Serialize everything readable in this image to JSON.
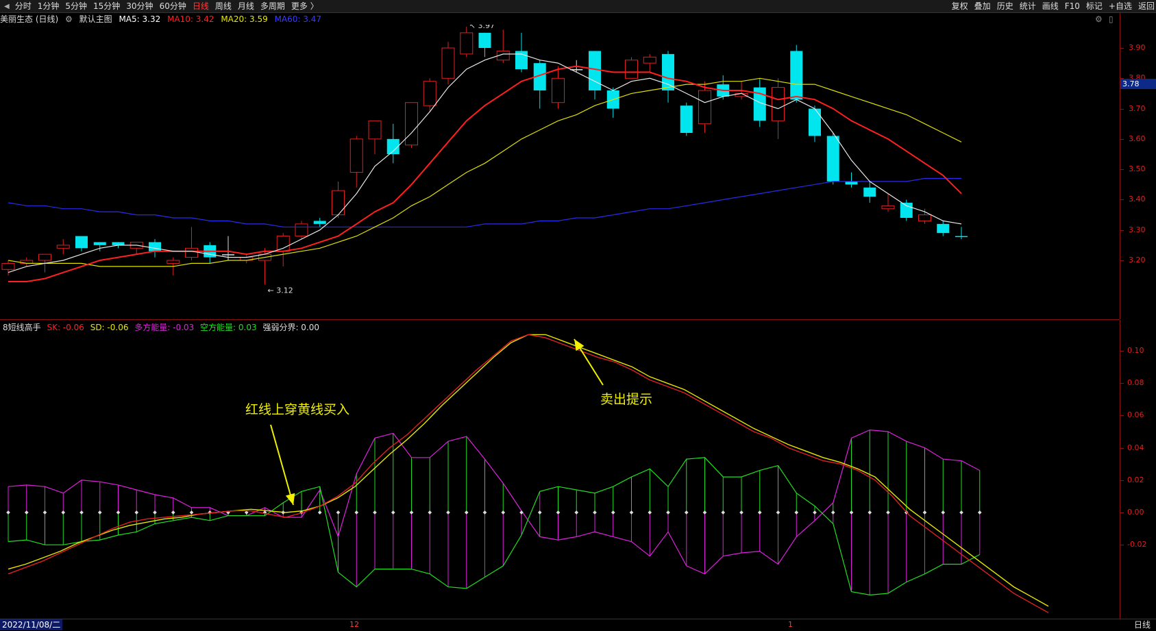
{
  "tabs": [
    {
      "label": "分时"
    },
    {
      "label": "1分钟"
    },
    {
      "label": "5分钟"
    },
    {
      "label": "15分钟"
    },
    {
      "label": "30分钟"
    },
    {
      "label": "60分钟"
    },
    {
      "label": "日线",
      "active": true
    },
    {
      "label": "周线"
    },
    {
      "label": "月线"
    },
    {
      "label": "多周期"
    },
    {
      "label": "更多 〉"
    }
  ],
  "right_tools": [
    {
      "label": "复权"
    },
    {
      "label": "叠加"
    },
    {
      "label": "历史"
    },
    {
      "label": "统计"
    },
    {
      "label": "画线"
    },
    {
      "label": "F10"
    },
    {
      "label": "标记"
    },
    {
      "label": "+自选"
    },
    {
      "label": "返回"
    }
  ],
  "main_info": {
    "stock": "美丽生态 (日线)",
    "layout": "默认主图",
    "ma5": "MA5: 3.32",
    "ma10": "MA10: 3.42",
    "ma20": "MA20: 3.59",
    "ma60": "MA60: 3.47",
    "colors": {
      "ma5": "#ffffff",
      "ma10": "#ff2020",
      "ma20": "#e8e800",
      "ma60": "#2a2aff"
    }
  },
  "indicator_info": {
    "name": "8短线高手",
    "sk": "SK: -0.06",
    "sd": "SD: -0.06",
    "duo": "多方能量: -0.03",
    "kong": "空方能量: 0.03",
    "qr": "强弱分界: 0.00"
  },
  "price_axis": [
    "3.90",
    "3.80",
    "3.70",
    "3.60",
    "3.50",
    "3.40",
    "3.30",
    "3.20"
  ],
  "price_current": "3.78",
  "ind_axis": [
    "0.10",
    "0.08",
    "0.06",
    "0.04",
    "0.02",
    "0.00",
    "-0.02"
  ],
  "annotations": {
    "buy": "红线上穿黄线买入",
    "sell": "卖出提示",
    "high": "3.97",
    "low": "3.12"
  },
  "bottom": {
    "date": "2022/11/08/二",
    "month12": "12",
    "month1": "1",
    "period": "日线"
  },
  "chart_data": {
    "type": "candlestick",
    "candles": [
      [
        3.17,
        3.19,
        3.15,
        3.2,
        "up"
      ],
      [
        3.19,
        3.2,
        3.18,
        3.21,
        "up"
      ],
      [
        3.2,
        3.22,
        3.16,
        3.22,
        "up"
      ],
      [
        3.24,
        3.25,
        3.22,
        3.27,
        "up"
      ],
      [
        3.28,
        3.24,
        3.23,
        3.28,
        "down"
      ],
      [
        3.26,
        3.25,
        3.23,
        3.26,
        "down"
      ],
      [
        3.26,
        3.25,
        3.24,
        3.26,
        "down"
      ],
      [
        3.24,
        3.26,
        3.22,
        3.26,
        "up"
      ],
      [
        3.26,
        3.23,
        3.21,
        3.27,
        "down"
      ],
      [
        3.19,
        3.2,
        3.15,
        3.21,
        "up"
      ],
      [
        3.21,
        3.24,
        3.2,
        3.31,
        "up"
      ],
      [
        3.25,
        3.21,
        3.19,
        3.26,
        "down"
      ],
      [
        3.22,
        3.21,
        3.2,
        3.28,
        "flat"
      ],
      [
        3.2,
        3.21,
        3.19,
        3.22,
        "up"
      ],
      [
        3.2,
        3.22,
        3.12,
        3.24,
        "up"
      ],
      [
        3.23,
        3.28,
        3.18,
        3.29,
        "up"
      ],
      [
        3.28,
        3.32,
        3.27,
        3.33,
        "up"
      ],
      [
        3.32,
        3.33,
        3.31,
        3.34,
        "down"
      ],
      [
        3.35,
        3.43,
        3.34,
        3.46,
        "up"
      ],
      [
        3.49,
        3.6,
        3.44,
        3.61,
        "up"
      ],
      [
        3.6,
        3.66,
        3.55,
        3.66,
        "up"
      ],
      [
        3.6,
        3.55,
        3.52,
        3.65,
        "down"
      ],
      [
        3.58,
        3.72,
        3.57,
        3.72,
        "up"
      ],
      [
        3.71,
        3.79,
        3.69,
        3.8,
        "up"
      ],
      [
        3.8,
        3.9,
        3.78,
        3.92,
        "up"
      ],
      [
        3.88,
        3.95,
        3.87,
        3.97,
        "up"
      ],
      [
        3.95,
        3.9,
        3.87,
        3.95,
        "down"
      ],
      [
        3.86,
        3.89,
        3.85,
        3.96,
        "up"
      ],
      [
        3.89,
        3.83,
        3.82,
        3.95,
        "down"
      ],
      [
        3.85,
        3.76,
        3.7,
        3.86,
        "down"
      ],
      [
        3.72,
        3.8,
        3.7,
        3.84,
        "up"
      ],
      [
        3.83,
        3.83,
        3.82,
        3.86,
        "flat"
      ],
      [
        3.89,
        3.76,
        3.73,
        3.89,
        "down"
      ],
      [
        3.76,
        3.7,
        3.67,
        3.77,
        "down"
      ],
      [
        3.8,
        3.86,
        3.8,
        3.87,
        "up"
      ],
      [
        3.85,
        3.87,
        3.82,
        3.88,
        "up"
      ],
      [
        3.88,
        3.76,
        3.72,
        3.89,
        "down"
      ],
      [
        3.71,
        3.62,
        3.61,
        3.72,
        "down"
      ],
      [
        3.65,
        3.76,
        3.62,
        3.79,
        "up"
      ],
      [
        3.78,
        3.74,
        3.73,
        3.81,
        "down"
      ],
      [
        3.74,
        3.75,
        3.73,
        3.79,
        "up"
      ],
      [
        3.77,
        3.66,
        3.64,
        3.8,
        "down"
      ],
      [
        3.66,
        3.77,
        3.6,
        3.8,
        "up"
      ],
      [
        3.89,
        3.73,
        3.72,
        3.91,
        "down"
      ],
      [
        3.7,
        3.61,
        3.59,
        3.71,
        "down"
      ],
      [
        3.61,
        3.46,
        3.45,
        3.62,
        "down"
      ],
      [
        3.46,
        3.45,
        3.44,
        3.49,
        "down"
      ],
      [
        3.44,
        3.41,
        3.39,
        3.46,
        "down"
      ],
      [
        3.37,
        3.38,
        3.36,
        3.42,
        "up"
      ],
      [
        3.39,
        3.34,
        3.33,
        3.4,
        "down"
      ],
      [
        3.33,
        3.35,
        3.32,
        3.37,
        "up"
      ],
      [
        3.32,
        3.29,
        3.28,
        3.33,
        "down"
      ],
      [
        3.28,
        3.28,
        3.27,
        3.31,
        "down"
      ]
    ],
    "ma5": [
      3.16,
      3.18,
      3.19,
      3.2,
      3.22,
      3.24,
      3.25,
      3.25,
      3.24,
      3.23,
      3.23,
      3.22,
      3.21,
      3.21,
      3.22,
      3.24,
      3.27,
      3.3,
      3.35,
      3.42,
      3.51,
      3.56,
      3.62,
      3.69,
      3.77,
      3.83,
      3.86,
      3.88,
      3.88,
      3.86,
      3.85,
      3.82,
      3.79,
      3.76,
      3.79,
      3.8,
      3.78,
      3.75,
      3.72,
      3.74,
      3.75,
      3.72,
      3.7,
      3.73,
      3.7,
      3.62,
      3.53,
      3.46,
      3.42,
      3.38,
      3.36,
      3.33,
      3.32
    ],
    "ma10": [
      3.13,
      3.13,
      3.14,
      3.16,
      3.18,
      3.2,
      3.21,
      3.22,
      3.23,
      3.23,
      3.23,
      3.23,
      3.23,
      3.22,
      3.23,
      3.23,
      3.24,
      3.26,
      3.28,
      3.32,
      3.36,
      3.39,
      3.45,
      3.52,
      3.59,
      3.66,
      3.71,
      3.75,
      3.79,
      3.81,
      3.83,
      3.84,
      3.83,
      3.82,
      3.82,
      3.82,
      3.8,
      3.79,
      3.77,
      3.76,
      3.76,
      3.75,
      3.73,
      3.74,
      3.73,
      3.7,
      3.66,
      3.63,
      3.6,
      3.56,
      3.52,
      3.48,
      3.42
    ],
    "ma20": [
      3.2,
      3.19,
      3.19,
      3.19,
      3.19,
      3.18,
      3.18,
      3.18,
      3.18,
      3.18,
      3.19,
      3.19,
      3.2,
      3.2,
      3.21,
      3.22,
      3.23,
      3.24,
      3.26,
      3.28,
      3.31,
      3.34,
      3.38,
      3.41,
      3.45,
      3.49,
      3.52,
      3.56,
      3.6,
      3.63,
      3.66,
      3.68,
      3.71,
      3.73,
      3.75,
      3.76,
      3.77,
      3.78,
      3.78,
      3.79,
      3.79,
      3.8,
      3.79,
      3.78,
      3.78,
      3.76,
      3.74,
      3.72,
      3.7,
      3.68,
      3.65,
      3.62,
      3.59
    ],
    "ma60": [
      3.39,
      3.38,
      3.38,
      3.37,
      3.37,
      3.36,
      3.36,
      3.35,
      3.35,
      3.34,
      3.34,
      3.33,
      3.33,
      3.32,
      3.32,
      3.31,
      3.31,
      3.31,
      3.31,
      3.31,
      3.31,
      3.31,
      3.31,
      3.31,
      3.31,
      3.31,
      3.32,
      3.32,
      3.32,
      3.33,
      3.33,
      3.34,
      3.34,
      3.35,
      3.36,
      3.37,
      3.37,
      3.38,
      3.39,
      3.4,
      3.41,
      3.42,
      3.43,
      3.44,
      3.45,
      3.46,
      3.46,
      3.46,
      3.46,
      3.46,
      3.47,
      3.47,
      3.47
    ],
    "sk": [
      -0.038,
      -0.034,
      -0.03,
      -0.025,
      -0.02,
      -0.015,
      -0.01,
      -0.006,
      -0.004,
      -0.003,
      -0.002,
      -0.001,
      0.0,
      0.001,
      0.001,
      -0.001,
      -0.003,
      0.0,
      0.004,
      0.01,
      0.018,
      0.03,
      0.04,
      0.048,
      0.058,
      0.068,
      0.078,
      0.088,
      0.097,
      0.106,
      0.11,
      0.108,
      0.104,
      0.1,
      0.096,
      0.093,
      0.088,
      0.082,
      0.078,
      0.074,
      0.068,
      0.062,
      0.056,
      0.05,
      0.046,
      0.04,
      0.036,
      0.032,
      0.03,
      0.026,
      0.02,
      0.01,
      -0.002,
      -0.01,
      -0.018,
      -0.026,
      -0.034,
      -0.042,
      -0.05,
      -0.056,
      -0.062
    ],
    "sd": [
      -0.035,
      -0.032,
      -0.028,
      -0.024,
      -0.019,
      -0.015,
      -0.011,
      -0.008,
      -0.006,
      -0.004,
      -0.003,
      -0.001,
      0.0,
      0.001,
      0.002,
      0.001,
      0.0,
      0.001,
      0.004,
      0.009,
      0.016,
      0.026,
      0.036,
      0.045,
      0.055,
      0.066,
      0.076,
      0.086,
      0.096,
      0.105,
      0.11,
      0.11,
      0.106,
      0.102,
      0.098,
      0.094,
      0.09,
      0.084,
      0.08,
      0.076,
      0.07,
      0.064,
      0.058,
      0.052,
      0.047,
      0.042,
      0.038,
      0.034,
      0.031,
      0.027,
      0.022,
      0.012,
      0.002,
      -0.006,
      -0.014,
      -0.022,
      -0.03,
      -0.038,
      -0.046,
      -0.052,
      -0.058
    ],
    "energy": [
      0.016,
      0.017,
      0.016,
      0.012,
      0.02,
      0.019,
      0.017,
      0.014,
      0.011,
      0.009,
      0.003,
      0.003,
      -0.002,
      -0.002,
      0.003,
      -0.003,
      -0.003,
      0.014,
      -0.015,
      0.024,
      0.046,
      0.049,
      0.034,
      0.034,
      0.044,
      0.047,
      0.033,
      0.018,
      0.001,
      -0.015,
      -0.017,
      -0.015,
      -0.012,
      -0.015,
      -0.018,
      -0.027,
      -0.012,
      -0.033,
      -0.038,
      -0.027,
      -0.025,
      -0.024,
      -0.032,
      -0.015,
      -0.005,
      0.006,
      0.046,
      0.051,
      0.05,
      0.044,
      0.04,
      0.033,
      0.032,
      0.026
    ],
    "energy_extra": [
      -0.018,
      -0.017,
      -0.02,
      -0.02,
      -0.018,
      -0.017,
      -0.014,
      -0.012,
      -0.007,
      -0.005,
      -0.003,
      -0.005,
      -0.002,
      -0.002,
      -0.002,
      0.006,
      0.013,
      0.016,
      -0.037,
      -0.046,
      -0.035,
      -0.035,
      -0.035,
      -0.038,
      -0.046,
      -0.047,
      -0.04,
      -0.033,
      -0.014,
      0.013,
      0.016,
      0.014,
      0.012,
      0.016,
      0.022,
      0.027,
      0.016,
      0.033,
      0.034,
      0.022,
      0.022,
      0.026,
      0.029,
      0.012,
      0.004,
      -0.007,
      -0.049,
      -0.051,
      -0.05,
      -0.043,
      -0.038,
      -0.032,
      -0.032,
      -0.026
    ]
  }
}
